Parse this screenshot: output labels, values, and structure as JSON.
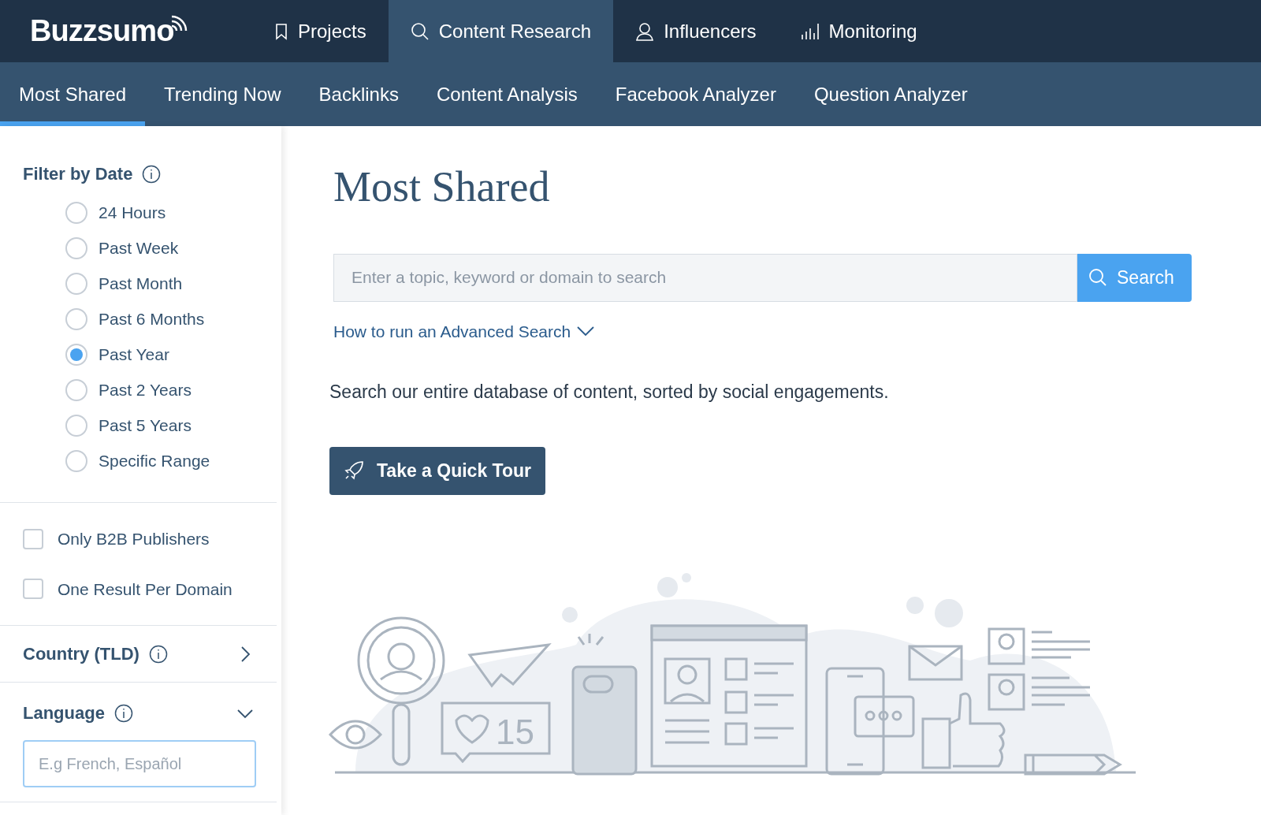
{
  "logo": {
    "text": "Buzzsumo"
  },
  "main_nav": [
    {
      "label": "Projects",
      "selected": false
    },
    {
      "label": "Content Research",
      "selected": true
    },
    {
      "label": "Influencers",
      "selected": false
    },
    {
      "label": "Monitoring",
      "selected": false
    }
  ],
  "sub_nav": [
    {
      "label": "Most Shared",
      "selected": true
    },
    {
      "label": "Trending Now",
      "selected": false
    },
    {
      "label": "Backlinks",
      "selected": false
    },
    {
      "label": "Content Analysis",
      "selected": false
    },
    {
      "label": "Facebook Analyzer",
      "selected": false
    },
    {
      "label": "Question Analyzer",
      "selected": false
    }
  ],
  "sidebar": {
    "date_filter": {
      "title": "Filter by Date",
      "options": [
        {
          "label": "24 Hours",
          "selected": false
        },
        {
          "label": "Past Week",
          "selected": false
        },
        {
          "label": "Past Month",
          "selected": false
        },
        {
          "label": "Past 6 Months",
          "selected": false
        },
        {
          "label": "Past Year",
          "selected": true
        },
        {
          "label": "Past 2 Years",
          "selected": false
        },
        {
          "label": "Past 5 Years",
          "selected": false
        },
        {
          "label": "Specific Range",
          "selected": false
        }
      ]
    },
    "checkboxes": [
      {
        "label": "Only B2B Publishers",
        "checked": false
      },
      {
        "label": "One Result Per Domain",
        "checked": false
      }
    ],
    "country": {
      "title": "Country (TLD)",
      "expanded": false
    },
    "language": {
      "title": "Language",
      "expanded": true,
      "placeholder": "E.g French, Español"
    }
  },
  "main": {
    "title": "Most Shared",
    "search": {
      "placeholder": "Enter a topic, keyword or domain to search",
      "button": "Search"
    },
    "advanced_link": "How to run an Advanced Search",
    "description": "Search our entire database of content, sorted by social engagements.",
    "tour_button": "Take a Quick Tour",
    "illustration": {
      "like_count": "15"
    }
  }
}
